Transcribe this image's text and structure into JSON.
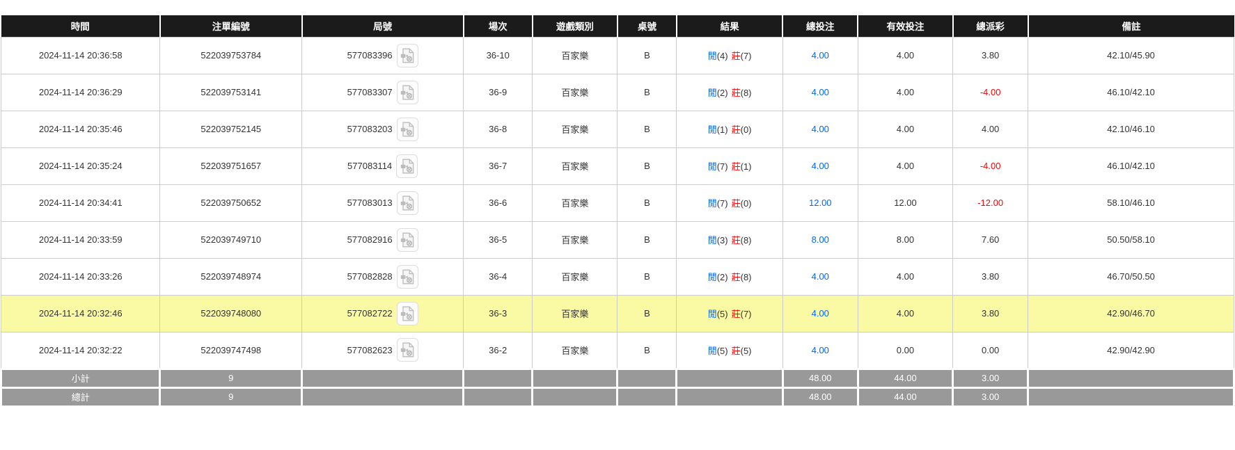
{
  "colors": {
    "header_bg": "#1b1b1b",
    "header_text": "#ffffff",
    "row_border": "#cccccc",
    "highlight_bg": "#fafaa5",
    "footer_bg": "#999999",
    "footer_text": "#ffffff",
    "link_blue": "#0066ff",
    "negative_red": "#ff0000",
    "body_text": "#333333"
  },
  "icons": {
    "replay": "video-file-icon"
  },
  "table": {
    "columns": [
      {
        "key": "time",
        "label": "時間"
      },
      {
        "key": "bet_id",
        "label": "注單編號"
      },
      {
        "key": "round",
        "label": "局號"
      },
      {
        "key": "session",
        "label": "場次"
      },
      {
        "key": "game_type",
        "label": "遊戲類別"
      },
      {
        "key": "table_no",
        "label": "桌號"
      },
      {
        "key": "result",
        "label": "結果"
      },
      {
        "key": "total_bet",
        "label": "總投注"
      },
      {
        "key": "valid_bet",
        "label": "有效投注"
      },
      {
        "key": "payout",
        "label": "總派彩"
      },
      {
        "key": "remark",
        "label": "備註"
      }
    ],
    "rows": [
      {
        "time": "2024-11-14 20:36:58",
        "bet_id": "522039753784",
        "round": "577083396",
        "session": "36-10",
        "game_type": "百家樂",
        "table_no": "B",
        "result": {
          "player": "閒",
          "player_pts": "(4)",
          "banker": "莊",
          "banker_pts": "(7)"
        },
        "total_bet": "4.00",
        "valid_bet": "4.00",
        "payout": "3.80",
        "remark": "42.10/45.90",
        "highlighted": false
      },
      {
        "time": "2024-11-14 20:36:29",
        "bet_id": "522039753141",
        "round": "577083307",
        "session": "36-9",
        "game_type": "百家樂",
        "table_no": "B",
        "result": {
          "player": "閒",
          "player_pts": "(2)",
          "banker": "莊",
          "banker_pts": "(8)"
        },
        "total_bet": "4.00",
        "valid_bet": "4.00",
        "payout": "-4.00",
        "remark": "46.10/42.10",
        "highlighted": false
      },
      {
        "time": "2024-11-14 20:35:46",
        "bet_id": "522039752145",
        "round": "577083203",
        "session": "36-8",
        "game_type": "百家樂",
        "table_no": "B",
        "result": {
          "player": "閒",
          "player_pts": "(1)",
          "banker": "莊",
          "banker_pts": "(0)"
        },
        "total_bet": "4.00",
        "valid_bet": "4.00",
        "payout": "4.00",
        "remark": "42.10/46.10",
        "highlighted": false
      },
      {
        "time": "2024-11-14 20:35:24",
        "bet_id": "522039751657",
        "round": "577083114",
        "session": "36-7",
        "game_type": "百家樂",
        "table_no": "B",
        "result": {
          "player": "閒",
          "player_pts": "(7)",
          "banker": "莊",
          "banker_pts": "(1)"
        },
        "total_bet": "4.00",
        "valid_bet": "4.00",
        "payout": "-4.00",
        "remark": "46.10/42.10",
        "highlighted": false
      },
      {
        "time": "2024-11-14 20:34:41",
        "bet_id": "522039750652",
        "round": "577083013",
        "session": "36-6",
        "game_type": "百家樂",
        "table_no": "B",
        "result": {
          "player": "閒",
          "player_pts": "(7)",
          "banker": "莊",
          "banker_pts": "(0)"
        },
        "total_bet": "12.00",
        "valid_bet": "12.00",
        "payout": "-12.00",
        "remark": "58.10/46.10",
        "highlighted": false
      },
      {
        "time": "2024-11-14 20:33:59",
        "bet_id": "522039749710",
        "round": "577082916",
        "session": "36-5",
        "game_type": "百家樂",
        "table_no": "B",
        "result": {
          "player": "閒",
          "player_pts": "(3)",
          "banker": "莊",
          "banker_pts": "(8)"
        },
        "total_bet": "8.00",
        "valid_bet": "8.00",
        "payout": "7.60",
        "remark": "50.50/58.10",
        "highlighted": false
      },
      {
        "time": "2024-11-14 20:33:26",
        "bet_id": "522039748974",
        "round": "577082828",
        "session": "36-4",
        "game_type": "百家樂",
        "table_no": "B",
        "result": {
          "player": "閒",
          "player_pts": "(2)",
          "banker": "莊",
          "banker_pts": "(8)"
        },
        "total_bet": "4.00",
        "valid_bet": "4.00",
        "payout": "3.80",
        "remark": "46.70/50.50",
        "highlighted": false
      },
      {
        "time": "2024-11-14 20:32:46",
        "bet_id": "522039748080",
        "round": "577082722",
        "session": "36-3",
        "game_type": "百家樂",
        "table_no": "B",
        "result": {
          "player": "閒",
          "player_pts": "(5)",
          "banker": "莊",
          "banker_pts": "(7)"
        },
        "total_bet": "4.00",
        "valid_bet": "4.00",
        "payout": "3.80",
        "remark": "42.90/46.70",
        "highlighted": true
      },
      {
        "time": "2024-11-14 20:32:22",
        "bet_id": "522039747498",
        "round": "577082623",
        "session": "36-2",
        "game_type": "百家樂",
        "table_no": "B",
        "result": {
          "player": "閒",
          "player_pts": "(5)",
          "banker": "莊",
          "banker_pts": "(5)"
        },
        "total_bet": "4.00",
        "valid_bet": "0.00",
        "payout": "0.00",
        "remark": "42.90/42.90",
        "highlighted": false
      }
    ],
    "footer_rows": [
      {
        "label": "小計",
        "count": "9",
        "total_bet": "48.00",
        "valid_bet": "44.00",
        "payout": "3.00"
      },
      {
        "label": "總計",
        "count": "9",
        "total_bet": "48.00",
        "valid_bet": "44.00",
        "payout": "3.00"
      }
    ]
  }
}
